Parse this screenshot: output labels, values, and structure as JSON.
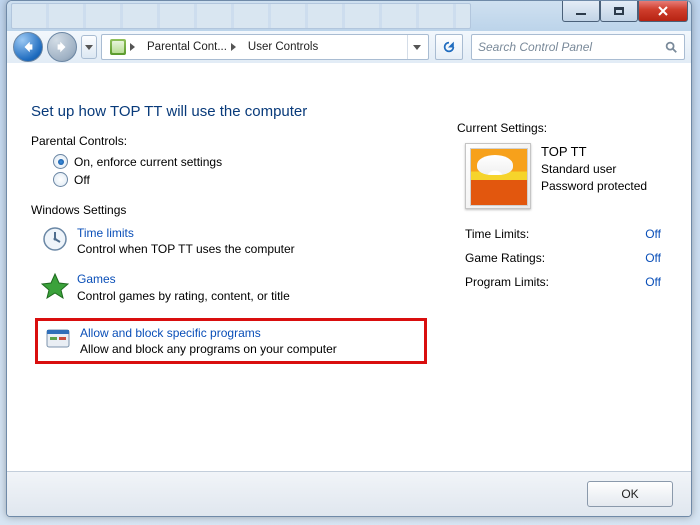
{
  "breadcrumb": {
    "seg1": "Parental Cont...",
    "seg2": "User Controls"
  },
  "search": {
    "placeholder": "Search Control Panel"
  },
  "page": {
    "title": "Set up how TOP TT will use the computer"
  },
  "parental": {
    "heading": "Parental Controls:",
    "on_label": "On, enforce current settings",
    "off_label": "Off",
    "selected": "on"
  },
  "winSettings": {
    "heading": "Windows Settings",
    "time": {
      "link": "Time limits",
      "desc": "Control when TOP TT uses the computer"
    },
    "games": {
      "link": "Games",
      "desc": "Control games by rating, content, or title"
    },
    "programs": {
      "link": "Allow and block specific programs",
      "desc": "Allow and block any programs on your computer"
    }
  },
  "current": {
    "heading": "Current Settings:",
    "user": {
      "name": "TOP TT",
      "type": "Standard user",
      "pwd": "Password protected"
    },
    "rows": {
      "time": {
        "label": "Time Limits:",
        "value": "Off"
      },
      "games": {
        "label": "Game Ratings:",
        "value": "Off"
      },
      "prog": {
        "label": "Program Limits:",
        "value": "Off"
      }
    }
  },
  "footer": {
    "ok": "OK"
  }
}
